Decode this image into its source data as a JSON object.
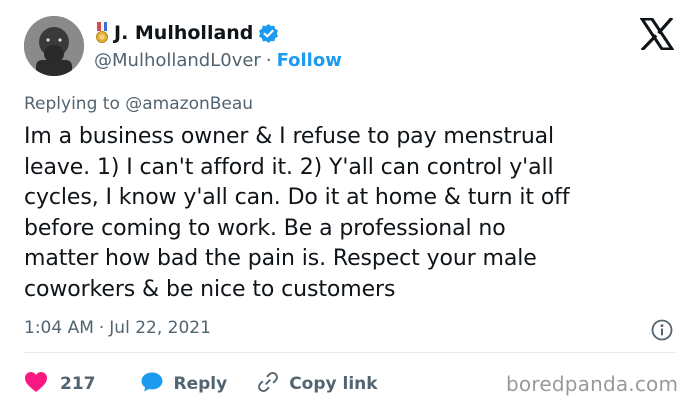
{
  "user": {
    "display_name": "J. Mulholland",
    "handle": "@MulhollandL0ver",
    "separator": "·",
    "follow_label": "Follow",
    "name_prefix_icon": "military-medal-icon",
    "verified_icon": "verified-badge-icon"
  },
  "reply_context": {
    "prefix": "Replying to",
    "handle": "@amazonBeau"
  },
  "tweet": {
    "text": "Im a business owner & I refuse to pay menstrual\nleave. 1) I can't afford it. 2) Y'all can control y'all\ncycles, I know y'all can. Do it at home & turn it off\nbefore coming to work. Be a professional no\nmatter how bad the pain is. Respect your male\ncoworkers & be nice to customers",
    "time": "1:04 AM",
    "separator": "·",
    "date": "Jul 22, 2021"
  },
  "actions": {
    "like_count": "217",
    "reply_label": "Reply",
    "copy_label": "Copy link"
  },
  "watermark": "boredpanda.com",
  "colors": {
    "link_blue": "#1d9bf0",
    "heart_red": "#f91880",
    "muted_gray": "#536471",
    "text_dark": "#0f1419"
  },
  "icons": {
    "platform": "x-logo-icon",
    "info": "info-icon",
    "like": "heart-icon",
    "reply": "reply-bubble-icon",
    "copy": "link-icon"
  }
}
